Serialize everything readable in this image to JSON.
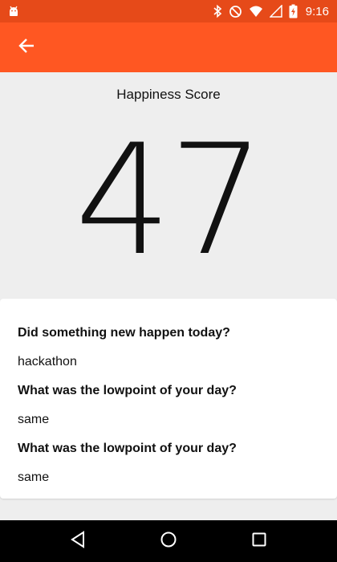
{
  "status_bar": {
    "time": "9:16",
    "icons": [
      "android-debug-icon",
      "bluetooth-icon",
      "do-not-disturb-icon",
      "wifi-icon",
      "signal-icon",
      "battery-charging-icon"
    ],
    "color": "#E64A19"
  },
  "app_bar": {
    "color": "#FF5722",
    "back_icon": "arrow-back-icon"
  },
  "score": {
    "label": "Happiness Score",
    "value": "47"
  },
  "entries": [
    {
      "question": "Did something new happen today?",
      "answer": "hackathon"
    },
    {
      "question": "What was the lowpoint of your day?",
      "answer": "same"
    },
    {
      "question": "What was the lowpoint of your day?",
      "answer": "same"
    }
  ],
  "nav_bar": {
    "buttons": [
      "back-triangle-icon",
      "home-circle-icon",
      "recents-square-icon"
    ]
  }
}
